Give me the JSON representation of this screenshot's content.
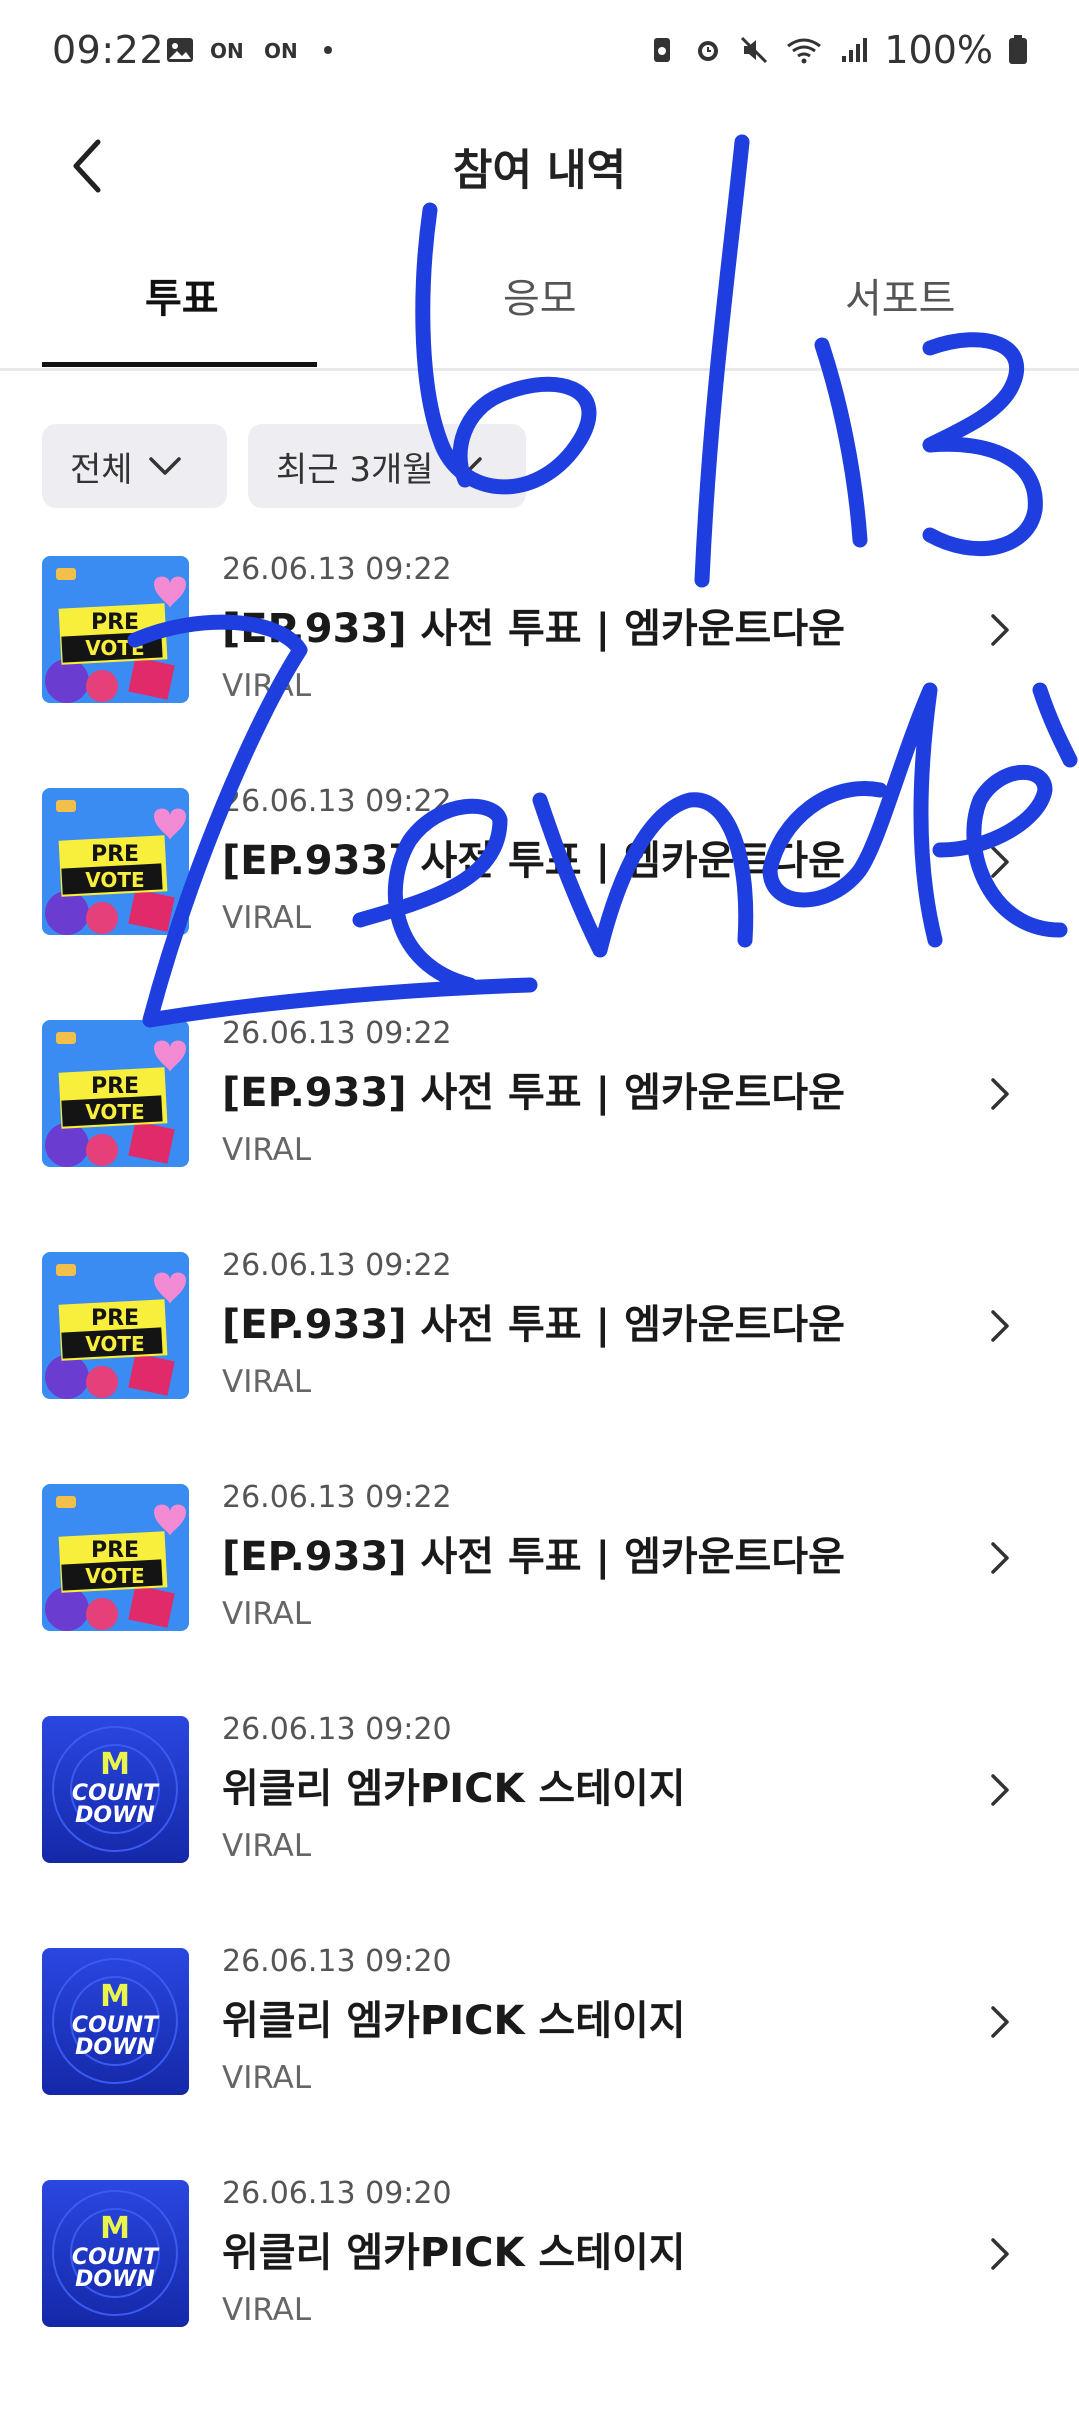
{
  "status_bar": {
    "time": "09:22",
    "battery_pct": "100%",
    "icons_left": [
      "image-icon",
      "on-badge-icon",
      "on-badge-icon",
      "dot-icon"
    ],
    "icons_right": [
      "battery-saver-icon",
      "alarm-icon",
      "mute-icon",
      "wifi-icon",
      "signal-icon",
      "battery-icon"
    ]
  },
  "header": {
    "title": "참여 내역",
    "back_icon": "chevron-left-icon"
  },
  "tabs": [
    {
      "label": "투표",
      "active": true
    },
    {
      "label": "응모",
      "active": false
    },
    {
      "label": "서포트",
      "active": false
    }
  ],
  "filters": {
    "category": "전체",
    "period": "최근 3개월"
  },
  "items": [
    {
      "date": "26.06.13 09:22",
      "title": "[EP.933] 사전 투표 | 엠카운트다운",
      "subtitle": "VIRAL",
      "thumb": "prevote"
    },
    {
      "date": "26.06.13 09:22",
      "title": "[EP.933] 사전 투표 | 엠카운트다운",
      "subtitle": "VIRAL",
      "thumb": "prevote"
    },
    {
      "date": "26.06.13 09:22",
      "title": "[EP.933] 사전 투표 | 엠카운트다운",
      "subtitle": "VIRAL",
      "thumb": "prevote"
    },
    {
      "date": "26.06.13 09:22",
      "title": "[EP.933] 사전 투표 | 엠카운트다운",
      "subtitle": "VIRAL",
      "thumb": "prevote"
    },
    {
      "date": "26.06.13 09:22",
      "title": "[EP.933] 사전 투표 | 엠카운트다운",
      "subtitle": "VIRAL",
      "thumb": "prevote"
    },
    {
      "date": "26.06.13 09:20",
      "title": "위클리 엠카PICK 스테이지",
      "subtitle": "VIRAL",
      "thumb": "countdown"
    },
    {
      "date": "26.06.13 09:20",
      "title": "위클리 엠카PICK 스테이지",
      "subtitle": "VIRAL",
      "thumb": "countdown"
    },
    {
      "date": "26.06.13 09:20",
      "title": "위클리 엠카PICK 스테이지",
      "subtitle": "VIRAL",
      "thumb": "countdown"
    }
  ],
  "thumbs": {
    "prevote": {
      "line1": "PRE",
      "line2": "VOTE"
    },
    "countdown": {
      "logo": "M",
      "line1": "COUNT",
      "line2": "DOWN"
    }
  },
  "handwriting": {
    "text": "6/13 Zendé",
    "color": "#1f3ee0"
  },
  "colors": {
    "accent": "#111111",
    "chip_bg": "#eeeef2",
    "divider": "#e8e8e8"
  }
}
